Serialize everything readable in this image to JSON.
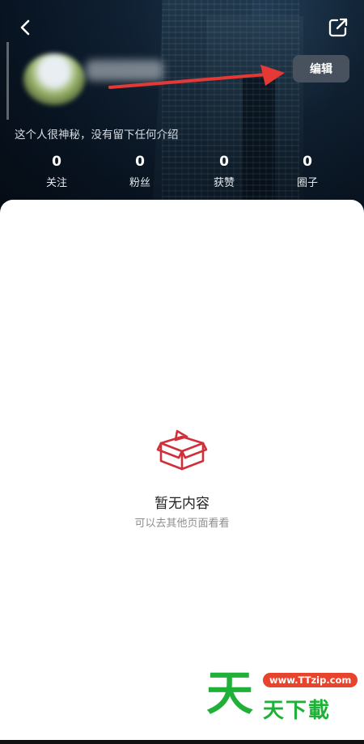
{
  "header": {
    "back_icon": "chevron-left-icon",
    "share_icon": "share-icon",
    "edit_label": "编辑",
    "bio": "这个人很神秘，没有留下任何介绍"
  },
  "stats": [
    {
      "value": "0",
      "label": "关注"
    },
    {
      "value": "0",
      "label": "粉丝"
    },
    {
      "value": "0",
      "label": "获赞"
    },
    {
      "value": "0",
      "label": "圈子"
    }
  ],
  "empty_state": {
    "icon": "open-box-icon",
    "title": "暂无内容",
    "subtitle": "可以去其他页面看看"
  },
  "watermark": {
    "big": "天",
    "url": "www.TTzip.com",
    "small": "天下載"
  },
  "colors": {
    "edit_button": "#48525e",
    "arrow": "#e53935",
    "empty_icon": "#d0303a",
    "watermark_green": "#1fb137",
    "watermark_red": "#e8432d"
  }
}
